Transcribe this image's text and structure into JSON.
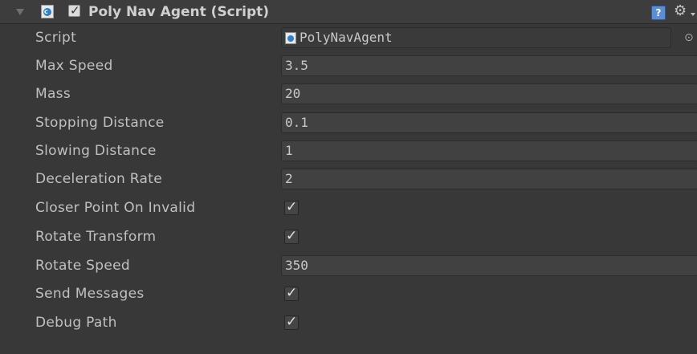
{
  "component": {
    "title": "Poly Nav Agent (Script)",
    "enabled": true,
    "icons": {
      "foldout": "foldout-arrow-icon",
      "script": "csharp-script-icon",
      "help": "help-book-icon",
      "settings": "gear-icon"
    },
    "help_glyph": "?",
    "gear_glyph": "⚙"
  },
  "properties": [
    {
      "label": "Script",
      "type": "object",
      "value": "PolyNavAgent",
      "picker_glyph": "⊙"
    },
    {
      "label": "Max Speed",
      "type": "float",
      "value": "3.5"
    },
    {
      "label": "Mass",
      "type": "float",
      "value": "20"
    },
    {
      "label": "Stopping Distance",
      "type": "float",
      "value": "0.1"
    },
    {
      "label": "Slowing Distance",
      "type": "float",
      "value": "1"
    },
    {
      "label": "Deceleration Rate",
      "type": "float",
      "value": "2"
    },
    {
      "label": "Closer Point On Invalid",
      "type": "bool",
      "value": true,
      "glyph": "✓"
    },
    {
      "label": "Rotate Transform",
      "type": "bool",
      "value": true,
      "glyph": "✓"
    },
    {
      "label": "Rotate Speed",
      "type": "float",
      "value": "350"
    },
    {
      "label": "Send Messages",
      "type": "bool",
      "value": true,
      "glyph": "✓"
    },
    {
      "label": "Debug Path",
      "type": "bool",
      "value": true,
      "glyph": "✓"
    }
  ],
  "colors": {
    "background": "#383838",
    "field": "#414141",
    "text": "#c0c0c0",
    "accent": "#2f7fcf"
  }
}
